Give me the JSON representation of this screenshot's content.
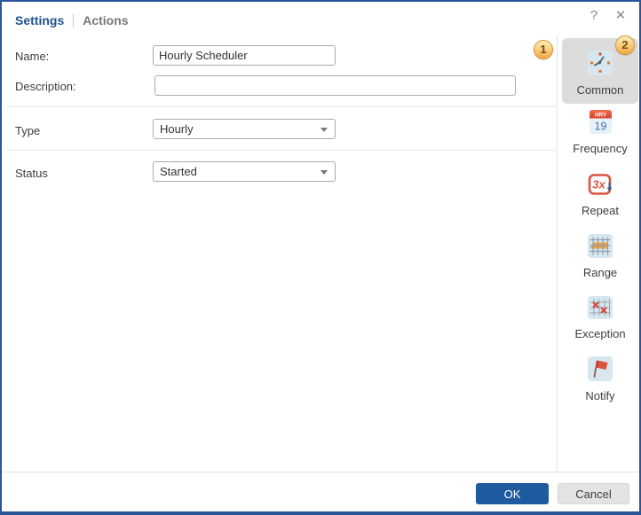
{
  "window": {
    "help_glyph": "?",
    "close_glyph": "✕",
    "tabs": [
      {
        "label": "Settings",
        "active": true
      },
      {
        "label": "Actions",
        "active": false
      }
    ]
  },
  "form": {
    "fields": [
      {
        "label": "Name:",
        "value": "Hourly Scheduler",
        "type": "text"
      },
      {
        "label": "Description:",
        "value": "",
        "type": "text"
      },
      {
        "label": "Type",
        "value": "Hourly",
        "type": "select"
      },
      {
        "label": "Status",
        "value": "Started",
        "type": "select"
      }
    ]
  },
  "badges": {
    "form_step": "1",
    "sidebar_step": "2"
  },
  "sidebar": {
    "items": [
      {
        "label": "Common",
        "icon": "clock-icon",
        "selected": true
      },
      {
        "label": "Frequency",
        "icon": "calendar-icon",
        "selected": false,
        "icon_top_text": "HRY",
        "icon_number": "19"
      },
      {
        "label": "Repeat",
        "icon": "repeat-icon",
        "selected": false,
        "icon_text": "3x"
      },
      {
        "label": "Range",
        "icon": "calendar-range-icon",
        "selected": false
      },
      {
        "label": "Exception",
        "icon": "calendar-exception-icon",
        "selected": false
      },
      {
        "label": "Notify",
        "icon": "flag-icon",
        "selected": false
      }
    ]
  },
  "footer": {
    "ok_label": "OK",
    "cancel_label": "Cancel"
  },
  "colors": {
    "accent_blue": "#2b579a",
    "ok_button_blue": "#1e5a9e",
    "active_tab_blue": "#1f5291",
    "selected_item_bg": "#dcdcdc",
    "icon_tile_blue": "#d7e7f0",
    "badge_orange": "#f2ab43",
    "icon_orange": "#e8791e",
    "icon_red": "#d9473a"
  }
}
